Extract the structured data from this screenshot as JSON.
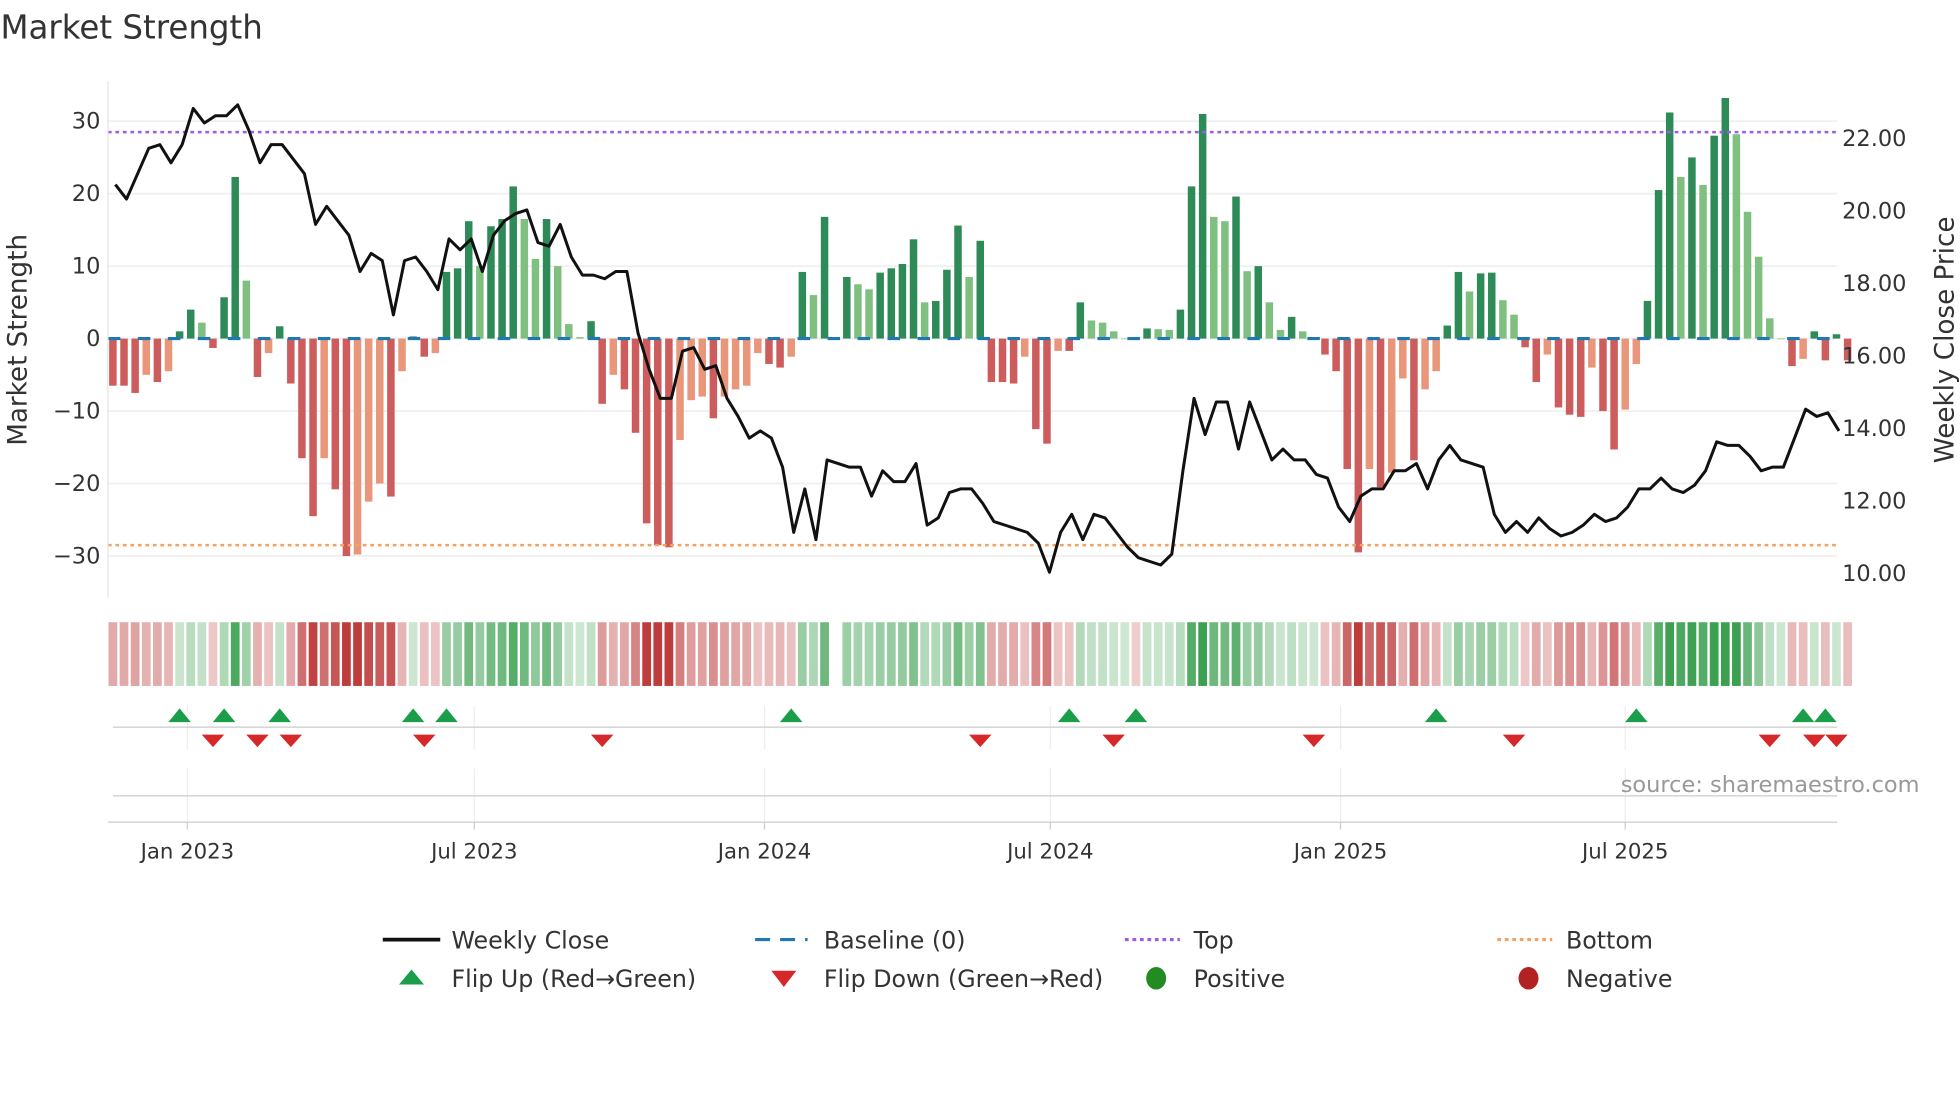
{
  "chart_data": {
    "type": "bar",
    "title": "Market Strength",
    "ylabel": "Market Strength",
    "ylabel_right": "Weekly Close Price",
    "ylim": [
      -36,
      36
    ],
    "ylim_right": [
      9.3,
      23.6
    ],
    "yticks": [
      "30",
      "20",
      "10",
      "0",
      "−10",
      "−20",
      "−30"
    ],
    "ytick_values": [
      30,
      20,
      10,
      0,
      -10,
      -20,
      -30
    ],
    "yticks_right": [
      "22.00",
      "20.00",
      "18.00",
      "16.00",
      "14.00",
      "12.00",
      "10.00"
    ],
    "ytick_right_values": [
      22,
      20,
      18,
      16,
      14,
      12,
      10
    ],
    "xticks": [
      "Jan 2023",
      "Jul 2023",
      "Jan 2024",
      "Jul 2024",
      "Jan 2025",
      "Jul 2025"
    ],
    "xtick_weeks": [
      6.7,
      32.5,
      58.6,
      84.3,
      110.4,
      136
    ],
    "top_level": 28.5,
    "bottom_level": -28.5,
    "grid": true,
    "strength": [
      -6.5,
      -6.5,
      -7.5,
      -5,
      -6,
      -4.5,
      1,
      4,
      2.2,
      -1.3,
      5.7,
      22.3,
      8,
      -5.3,
      -2,
      1.7,
      -6.2,
      -16.5,
      -24.5,
      -16.5,
      -20.8,
      -30,
      -29.8,
      -22.5,
      -20,
      -21.8,
      -4.5,
      0.3,
      -2.5,
      -2,
      9.2,
      9.7,
      16.2,
      10,
      15.5,
      16.5,
      21,
      16.5,
      11,
      16.5,
      10,
      2,
      0.2,
      2.4,
      -9,
      -5,
      -7,
      -13,
      -25.5,
      -28.5,
      -28.8,
      -14,
      -8.5,
      -8,
      -11,
      -8,
      -7,
      -6.5,
      -2,
      -3.5,
      -4,
      -2.5,
      9.2,
      6,
      16.8,
      0,
      8.5,
      7.5,
      6.8,
      9.1,
      9.7,
      10.3,
      13.7,
      5,
      5.2,
      9.5,
      15.6,
      8.5,
      13.5,
      -6,
      -6,
      -6.2,
      -2.5,
      -12.5,
      -14.5,
      -1.7,
      -1.7,
      5,
      2.5,
      2.2,
      1,
      0,
      -0.2,
      1.4,
      1.3,
      1.2,
      4,
      21,
      31,
      16.8,
      16.2,
      19.6,
      9.3,
      10,
      5,
      1.2,
      3,
      1,
      0.2,
      -2.2,
      -4.5,
      -18,
      -29.5,
      -18,
      -20.5,
      -18.5,
      -5.5,
      -16.8,
      -7,
      -4.5,
      1.8,
      9.2,
      6.5,
      9,
      9.1,
      5.3,
      3.3,
      -1.2,
      -6,
      -2.2,
      -9.5,
      -10.5,
      -10.8,
      -4,
      -10,
      -15.3,
      -9.8,
      -3.5,
      5.2,
      20.5,
      31.2,
      22.3,
      25,
      21.2,
      28,
      33.2,
      28.2,
      17.5,
      11.3,
      2.8,
      0,
      -3.8,
      -2.8,
      1,
      -3,
      0.6,
      -3
    ],
    "weekly_close": [
      20.7,
      20.3,
      21,
      21.7,
      21.8,
      21.3,
      21.8,
      22.8,
      22.4,
      22.6,
      22.6,
      22.9,
      22.2,
      21.3,
      21.8,
      21.8,
      21.4,
      21,
      19.6,
      20.1,
      19.7,
      19.3,
      18.3,
      18.8,
      18.6,
      17.1,
      18.6,
      18.7,
      18.3,
      17.8,
      19.2,
      18.9,
      19.2,
      18.3,
      19.3,
      19.7,
      19.9,
      20,
      19.1,
      19,
      19.6,
      18.7,
      18.2,
      18.2,
      18.1,
      18.3,
      18.3,
      16.6,
      15.6,
      14.8,
      14.8,
      16.1,
      16.2,
      15.6,
      15.7,
      14.8,
      14.3,
      13.7,
      13.9,
      13.7,
      12.9,
      11.1,
      12.3,
      10.9,
      13.1,
      13,
      12.9,
      12.9,
      12.1,
      12.8,
      12.5,
      12.5,
      13,
      11.3,
      11.5,
      12.2,
      12.3,
      12.3,
      11.9,
      11.4,
      11.3,
      11.2,
      11.1,
      10.8,
      10,
      11.1,
      11.6,
      10.9,
      11.6,
      11.5,
      11.1,
      10.7,
      10.4,
      10.3,
      10.2,
      10.5,
      12.8,
      14.8,
      13.8,
      14.7,
      14.7,
      13.4,
      14.7,
      13.9,
      13.1,
      13.4,
      13.1,
      13.1,
      12.7,
      12.6,
      11.8,
      11.4,
      12.1,
      12.3,
      12.3,
      12.8,
      12.8,
      13,
      12.3,
      13.1,
      13.5,
      13.1,
      13,
      12.9,
      11.6,
      11.1,
      11.4,
      11.1,
      11.5,
      11.2,
      11,
      11.1,
      11.3,
      11.6,
      11.4,
      11.5,
      11.8,
      12.3,
      12.3,
      12.6,
      12.3,
      12.2,
      12.4,
      12.8,
      13.6,
      13.5,
      13.5,
      13.2,
      12.8,
      12.9,
      12.9,
      13.7,
      14.5,
      14.3,
      14.4,
      13.9
    ],
    "flip_up_weeks": [
      6,
      10,
      15,
      27,
      30,
      61,
      86,
      92,
      119,
      137,
      152,
      154
    ],
    "flip_down_weeks": [
      9,
      13,
      16,
      28,
      44,
      78,
      90,
      108,
      126,
      149,
      153,
      155
    ],
    "legend": {
      "placement": "bottom",
      "items": [
        {
          "label": "Weekly Close",
          "symbol": "line",
          "color": "#111111"
        },
        {
          "label": "Baseline (0)",
          "symbol": "dash",
          "color": "#1f77b4"
        },
        {
          "label": "Top",
          "symbol": "dot",
          "color": "#9b5de5"
        },
        {
          "label": "Bottom",
          "symbol": "dot",
          "color": "#f4a261"
        },
        {
          "label": "Flip Up (Red→Green)",
          "symbol": "triangle-up",
          "color": "#1a9e4a"
        },
        {
          "label": "Flip Down (Green→Red)",
          "symbol": "triangle-down",
          "color": "#d62828"
        },
        {
          "label": "Positive",
          "symbol": "circle",
          "color": "#228b22"
        },
        {
          "label": "Negative",
          "symbol": "circle",
          "color": "#b22222"
        }
      ]
    },
    "colors": {
      "pos_rising": "#2e8b57",
      "pos_falling": "#7fbf7f",
      "neg_falling": "#cd5c5c",
      "neg_rising": "#e9967a",
      "baseline": "#1f77b4",
      "top": "#9b5de5",
      "bottom": "#f4a261"
    },
    "source": "source: sharemaestro.com"
  }
}
